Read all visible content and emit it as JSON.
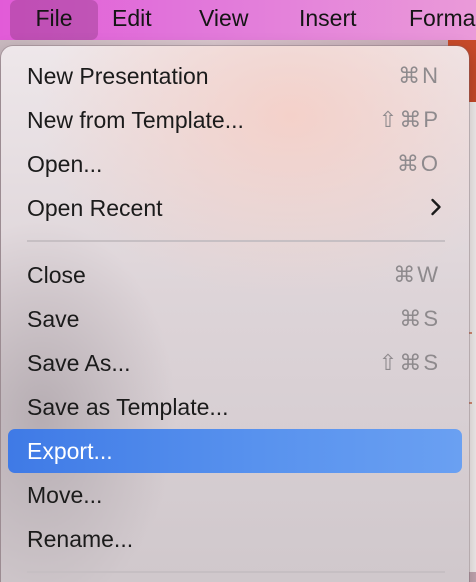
{
  "menubar": {
    "items": [
      "File",
      "Edit",
      "View",
      "Insert",
      "Forma"
    ]
  },
  "file_menu": {
    "groups": [
      [
        {
          "label": "New Presentation",
          "shortcut": "⌘N"
        },
        {
          "label": "New from Template...",
          "shortcut": "⇧⌘P"
        },
        {
          "label": "Open...",
          "shortcut": "⌘O"
        },
        {
          "label": "Open Recent",
          "submenu": true
        }
      ],
      [
        {
          "label": "Close",
          "shortcut": "⌘W"
        },
        {
          "label": "Save",
          "shortcut": "⌘S"
        },
        {
          "label": "Save As...",
          "shortcut": "⇧⌘S"
        },
        {
          "label": "Save as Template..."
        },
        {
          "label": "Export...",
          "highlighted": true
        },
        {
          "label": "Move..."
        },
        {
          "label": "Rename..."
        }
      ]
    ]
  },
  "colors": {
    "highlight": "#4a86ec",
    "menubar_accent": "#e25bd8"
  },
  "icons": {
    "open_recent": "chevron-right-icon"
  }
}
